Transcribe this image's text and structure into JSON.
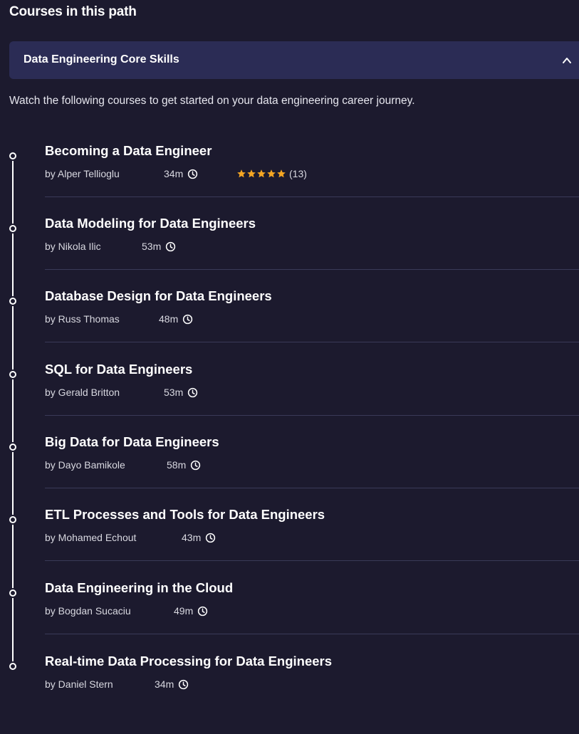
{
  "section_title": "Courses in this path",
  "accordion": {
    "title": "Data Engineering Core Skills",
    "state_icon": "chevron-up-icon"
  },
  "intro": "Watch the following courses to get started on your data engineering career journey.",
  "courses": [
    {
      "title": "Becoming a Data Engineer",
      "author": "by Alper Tellioglu",
      "duration": "34m",
      "rating_count": "(13)",
      "stars": 5
    },
    {
      "title": "Data Modeling for Data Engineers",
      "author": "by Nikola Ilic",
      "duration": "53m"
    },
    {
      "title": "Database Design for Data Engineers",
      "author": "by Russ Thomas",
      "duration": "48m"
    },
    {
      "title": "SQL for Data Engineers",
      "author": "by Gerald Britton",
      "duration": "53m"
    },
    {
      "title": "Big Data for Data Engineers",
      "author": "by Dayo Bamikole",
      "duration": "58m"
    },
    {
      "title": "ETL Processes and Tools for Data Engineers",
      "author": "by Mohamed Echout",
      "duration": "43m"
    },
    {
      "title": "Data Engineering in the Cloud",
      "author": "by Bogdan Sucaciu",
      "duration": "49m"
    },
    {
      "title": "Real-time Data Processing for Data Engineers",
      "author": "by Daniel Stern",
      "duration": "34m"
    }
  ],
  "colors": {
    "background": "#1c1a2e",
    "accordion": "#2b2c55",
    "star": "#f5a623",
    "divider": "#3a3a58"
  }
}
